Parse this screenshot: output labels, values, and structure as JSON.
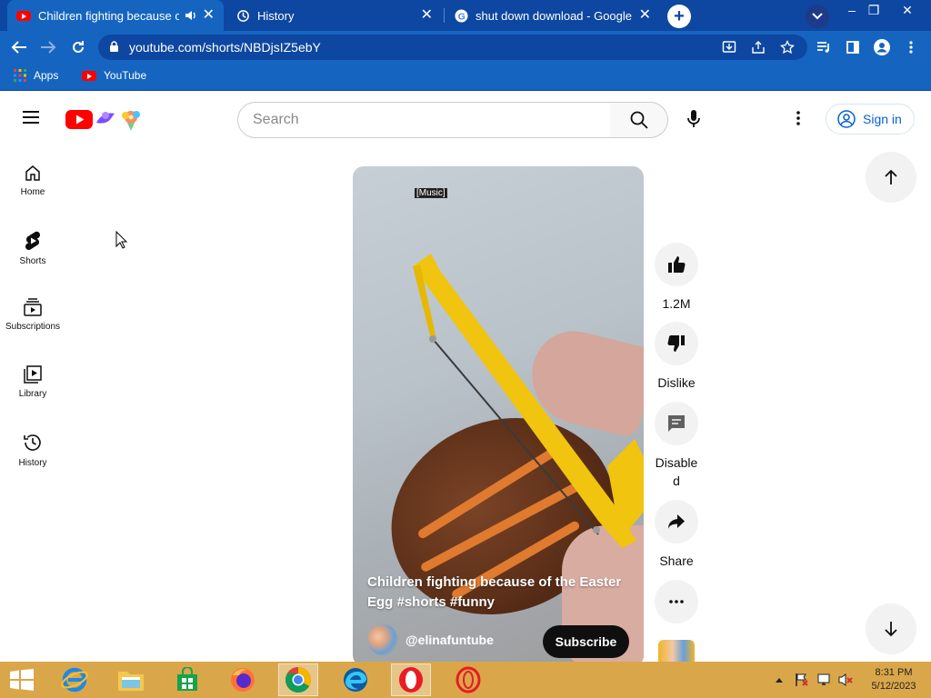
{
  "browser": {
    "tabs": [
      {
        "title": "Children fighting because of the Easter Egg #shorts #funny",
        "active": true
      },
      {
        "title": "History",
        "active": false
      },
      {
        "title": "shut down download - Google Search",
        "active": false
      }
    ],
    "url": "youtube.com/shorts/NBDjsIZ5ebY",
    "bookmarks": [
      {
        "label": "Apps"
      },
      {
        "label": "YouTube"
      }
    ]
  },
  "header": {
    "search_placeholder": "Search",
    "signin_label": "Sign in"
  },
  "sidebar": {
    "items": [
      {
        "label": "Home",
        "icon": "home-icon"
      },
      {
        "label": "Shorts",
        "icon": "shorts-icon"
      },
      {
        "label": "Subscriptions",
        "icon": "subscriptions-icon"
      },
      {
        "label": "Library",
        "icon": "library-icon"
      },
      {
        "label": "History",
        "icon": "history-icon"
      }
    ]
  },
  "short": {
    "music_tag": "[Music]",
    "title_line1": "Children fighting because of the Easter",
    "title_line2": "Egg #shorts #funny",
    "channel": "@elinafuntube",
    "subscribe_label": "Subscribe"
  },
  "actions": {
    "like_count": "1.2M",
    "dislike_label": "Dislike",
    "comments_label_1": "Disable",
    "comments_label_2": "d",
    "share_label": "Share"
  },
  "taskbar": {
    "time": "8:31 PM",
    "date": "5/12/2023"
  },
  "colors": {
    "tab_strip": "#0d47a1",
    "toolbar": "#1565c0",
    "youtube_red": "#ff0000",
    "taskbar": "#d9a74a",
    "link_blue": "#065fd4"
  }
}
